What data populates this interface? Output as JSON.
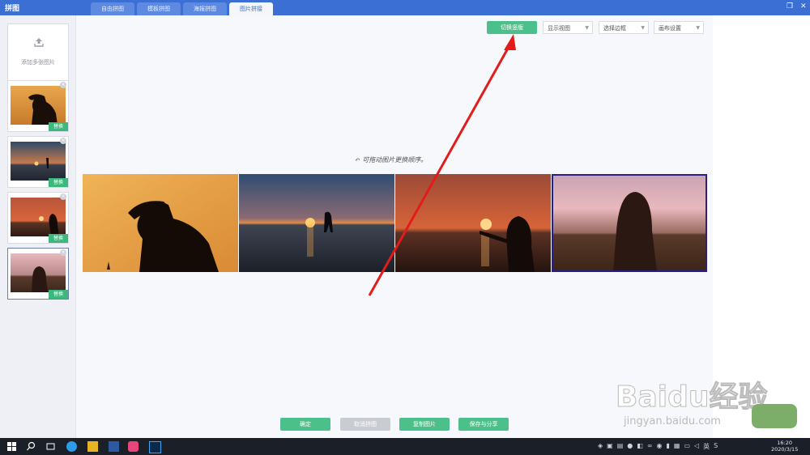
{
  "app": {
    "title": "拼图"
  },
  "tabs": [
    {
      "label": "自由拼图"
    },
    {
      "label": "模板拼图"
    },
    {
      "label": "海报拼图"
    },
    {
      "label": "图片拼接"
    }
  ],
  "sidebar": {
    "add_label": "添加多张图片",
    "badge_label": "替换"
  },
  "toolbar": {
    "switch_label": "切换竖版",
    "view_label": "显示视图",
    "border_label": "选择边框",
    "canvas_label": "画布设置"
  },
  "canvas": {
    "hint": "可拖动图片更换顺序。"
  },
  "actions": {
    "confirm": "确定",
    "cancel": "取消拼图",
    "copy": "复制图片",
    "save_share": "保存与分享"
  },
  "taskbar": {
    "time": "16:20",
    "date": "2020/3/15",
    "ime": "英"
  },
  "watermark": {
    "brand": "Baidu经验",
    "url": "jingyan.baidu.com"
  },
  "colors": {
    "accent": "#4cc08a",
    "titlebar": "#3b6fd3",
    "selected_border": "#2a1f86"
  }
}
